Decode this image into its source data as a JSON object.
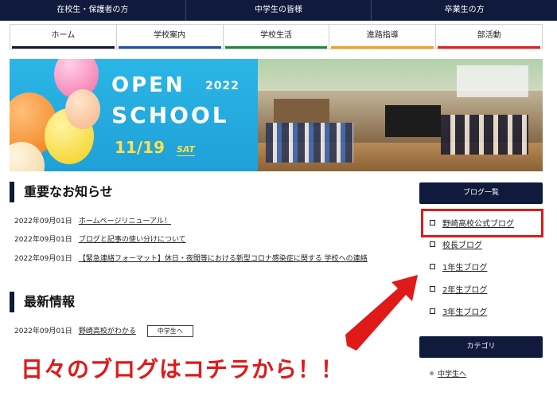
{
  "topbar": {
    "items": [
      "在校生・保護者の方",
      "中学生の皆様",
      "卒業生の方"
    ]
  },
  "nav": {
    "items": [
      {
        "label": "ホーム",
        "color": "#0f1a3c"
      },
      {
        "label": "学校案内",
        "color": "#1f4fa8"
      },
      {
        "label": "学校生活",
        "color": "#1f8a3a"
      },
      {
        "label": "進路指導",
        "color": "#f0a21c"
      },
      {
        "label": "部活動",
        "color": "#e02020"
      }
    ]
  },
  "hero": {
    "title_line1": "OPEN",
    "year": "2022",
    "title_line2": "SCHOOL",
    "date": "11/19",
    "day": "SAT"
  },
  "important": {
    "heading": "重要なお知らせ",
    "items": [
      {
        "date": "2022年09月01日",
        "text": "ホームページリニューアル！"
      },
      {
        "date": "2022年09月01日",
        "text": "ブログと記事の使い分けについて"
      },
      {
        "date": "2022年09月01日",
        "text": "【緊急連絡フォーマット】休日・夜間等における新型コロナ感染症に関する 学校への連絡"
      }
    ]
  },
  "latest": {
    "heading": "最新情報",
    "items": [
      {
        "date": "2022年09月01日",
        "text": "野崎高校がわかる",
        "tag": "中学生へ"
      }
    ]
  },
  "sidebar": {
    "blog_heading": "ブログ一覧",
    "blogs": [
      "野崎高校公式ブログ",
      "校長ブログ",
      "1年生ブログ",
      "2年生ブログ",
      "3年生ブログ"
    ],
    "category_heading": "カテゴリ",
    "categories": [
      "中学生へ"
    ]
  },
  "annotation": {
    "text": "日々のブログはコチラから！！",
    "color": "#e01919"
  },
  "colors": {
    "navy": "#0f1a3c",
    "accent_red": "#e01919",
    "banner_blue": "#1fa0d8"
  }
}
